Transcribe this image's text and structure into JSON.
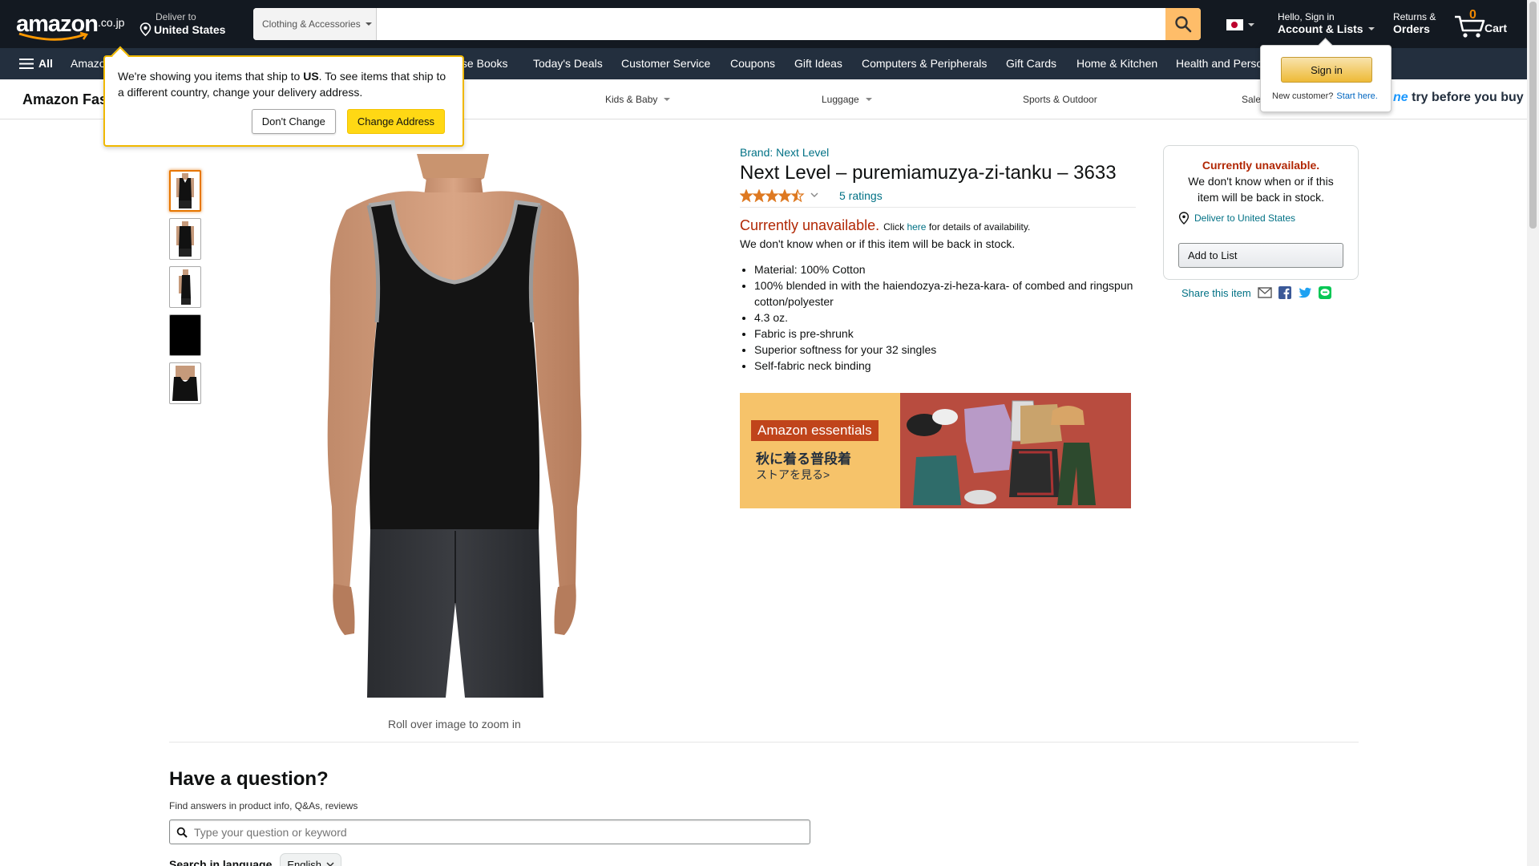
{
  "header": {
    "logo_text": "amazon",
    "logo_tld": ".co.jp",
    "deliver_line1": "Deliver to",
    "deliver_line2": "United States",
    "search_category": "Clothing & Accessories",
    "search_placeholder": "",
    "account_line1": "Hello, Sign in",
    "account_line2": "Account & Lists",
    "returns_line1": "Returns &",
    "returns_line2": "Orders",
    "cart_count": "0",
    "cart_label": "Cart"
  },
  "subnav": {
    "all_label": "All",
    "items": [
      "Amazon",
      "Japanese Books",
      "Today's Deals",
      "Customer Service",
      "Coupons",
      "Gift Ideas",
      "Computers & Peripherals",
      "Gift Cards",
      "Home & Kitchen",
      "Health and Personal"
    ]
  },
  "storebar": {
    "brand": "Amazon Fashion",
    "categories": [
      "Kids & Baby",
      "Luggage",
      "Sports & Outdoor",
      "Sale"
    ],
    "prime_prefix": "ne",
    "prime_text": "try before you buy"
  },
  "ship_popover": {
    "msg_pre": "We're showing you items that ship to ",
    "msg_bold": "US",
    "msg_post": ". To see items that ship to a different country, change your delivery address.",
    "dont_change": "Don't Change",
    "change_address": "Change Address"
  },
  "signin_popover": {
    "button": "Sign in",
    "new_customer": "New customer?",
    "start_here": "Start here."
  },
  "product": {
    "brand_link": "Brand: Next Level",
    "title": "Next Level – puremiamuzya-zi-tanku – 3633",
    "rating": 4.5,
    "ratings_count": "5 ratings",
    "unavailable": "Currently unavailable.",
    "click": "Click",
    "here": "here",
    "details": "for details of availability.",
    "unavailable_note": "We don't know when or if this item will be back in stock.",
    "bullets": [
      "Material: 100% Cotton",
      "100% blended in with the haiendozya-zi-heza-kara- of combed and ringspun cotton/polyester",
      "4.3 oz.",
      "Fabric is pre-shrunk",
      "Superior softness for your 32 singles",
      "Self-fabric neck binding"
    ],
    "zoom_hint": "Roll over image to zoom in",
    "banner_brand": "Amazon essentials",
    "banner_line1": "秋に着る普段着",
    "banner_line2": "ストアを見る>"
  },
  "buybox": {
    "unavailable": "Currently unavailable.",
    "note": "We don't know when or if this item will be back in stock.",
    "deliver": "Deliver to United States",
    "add_to_list": "Add to List",
    "share": "Share this item"
  },
  "question": {
    "title": "Have a question?",
    "subtitle": "Find answers in product info, Q&As, reviews",
    "placeholder": "Type your question or keyword",
    "lang_label": "Search in language",
    "lang_value": "English"
  },
  "colors": {
    "nav_dark": "#131921",
    "nav_secondary": "#232f3e",
    "accent_orange": "#febd69",
    "price_red": "#b12704",
    "link_teal": "#007185"
  }
}
